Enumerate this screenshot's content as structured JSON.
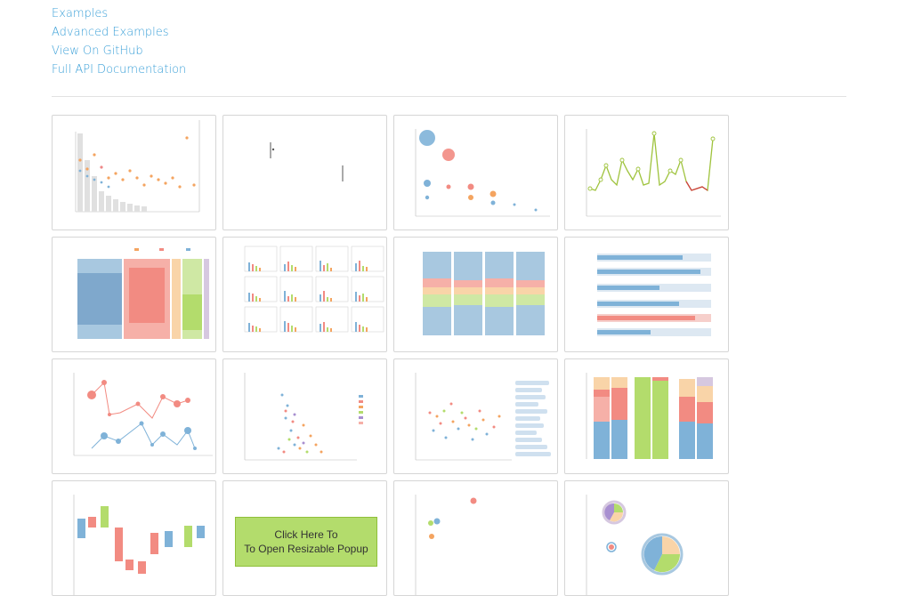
{
  "nav": {
    "links": [
      "Examples",
      "Advanced Examples",
      "View On GitHub",
      "Full API Documentation"
    ]
  },
  "gallery": {
    "popup_button": {
      "line1": "Click Here To",
      "line2": "To Open Resizable Popup"
    }
  }
}
